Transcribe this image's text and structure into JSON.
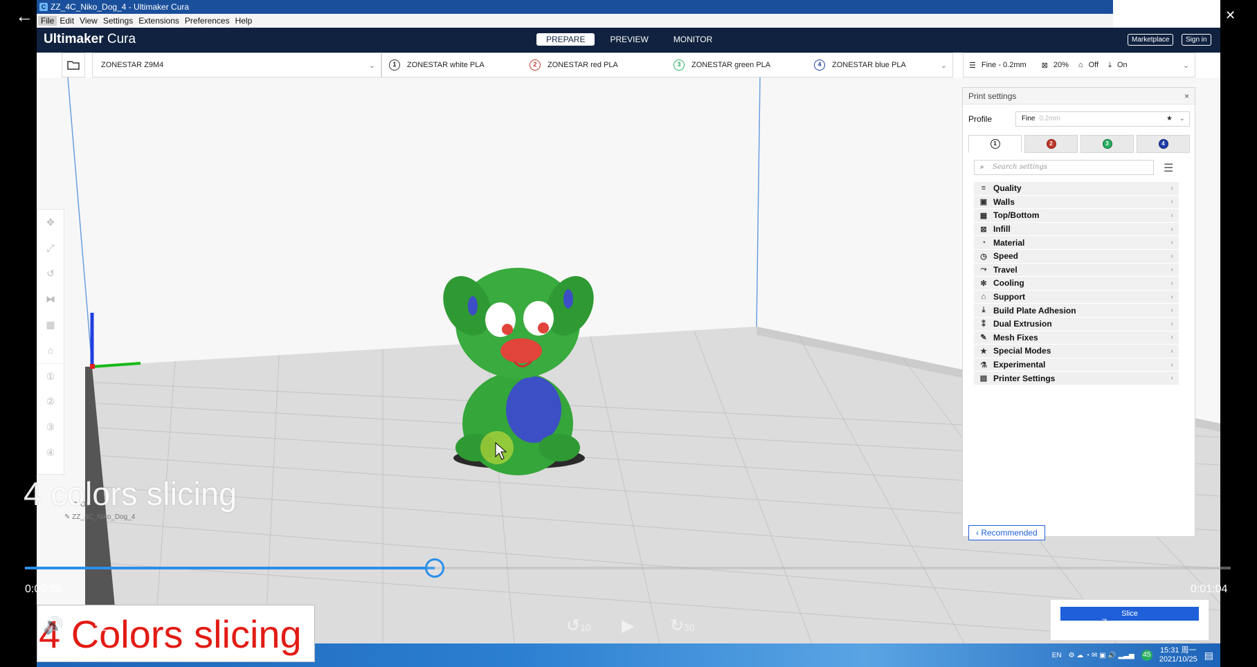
{
  "window": {
    "title": "ZZ_4C_Niko_Dog_4 - Ultimaker Cura"
  },
  "menu": [
    "File",
    "Edit",
    "View",
    "Settings",
    "Extensions",
    "Preferences",
    "Help"
  ],
  "header": {
    "brand_bold": "Ultimaker",
    "brand_rest": " Cura",
    "stages": [
      "PREPARE",
      "PREVIEW",
      "MONITOR"
    ],
    "active_stage": "PREPARE",
    "marketplace": "Marketplace",
    "signin": "Sign in"
  },
  "toolbar": {
    "printer": "ZONESTAR Z9M4",
    "extruders": [
      {
        "num": "1",
        "label": "ZONESTAR white PLA",
        "color": "#333333"
      },
      {
        "num": "2",
        "label": "ZONESTAR red PLA",
        "color": "#c0392b"
      },
      {
        "num": "3",
        "label": "ZONESTAR green PLA",
        "color": "#27ae60"
      },
      {
        "num": "4",
        "label": "ZONESTAR blue PLA",
        "color": "#1f3fa8"
      }
    ],
    "quality": "Fine - 0.2mm",
    "infill": "20%",
    "support": "Off",
    "adhesion": "On"
  },
  "panel": {
    "title": "Print settings",
    "close": "×",
    "profile_label": "Profile",
    "profile_value": "Fine",
    "profile_sub": "0.2mm",
    "search_placeholder": "Search settings",
    "categories": [
      {
        "icon": "quality-icon",
        "glyph": "≡",
        "label": "Quality"
      },
      {
        "icon": "walls-icon",
        "glyph": "▣",
        "label": "Walls"
      },
      {
        "icon": "top-bottom-icon",
        "glyph": "▦",
        "label": "Top/Bottom"
      },
      {
        "icon": "infill-icon",
        "glyph": "⊠",
        "label": "Infill"
      },
      {
        "icon": "material-icon",
        "glyph": "◔",
        "label": "Material"
      },
      {
        "icon": "speed-icon",
        "glyph": "◷",
        "label": "Speed"
      },
      {
        "icon": "travel-icon",
        "glyph": "⤳",
        "label": "Travel"
      },
      {
        "icon": "cooling-icon",
        "glyph": "✻",
        "label": "Cooling"
      },
      {
        "icon": "support-icon",
        "glyph": "⌂",
        "label": "Support"
      },
      {
        "icon": "adhesion-icon",
        "glyph": "⤓",
        "label": "Build Plate Adhesion"
      },
      {
        "icon": "dual-extrusion-icon",
        "glyph": "⁑",
        "label": "Dual Extrusion"
      },
      {
        "icon": "mesh-fixes-icon",
        "glyph": "✎",
        "label": "Mesh Fixes"
      },
      {
        "icon": "special-modes-icon",
        "glyph": "★",
        "label": "Special Modes"
      },
      {
        "icon": "experimental-icon",
        "glyph": "⚗",
        "label": "Experimental"
      },
      {
        "icon": "printer-settings-icon",
        "glyph": "▤",
        "label": "Printer Settings"
      }
    ],
    "recommended": "Recommended"
  },
  "slice": {
    "label": "Slice"
  },
  "object_list": {
    "header": "Ob",
    "item": "ZZ_4C_Niko_Dog_4"
  },
  "video": {
    "caption": "4 colors slicing",
    "red_caption": "4 Colors slicing",
    "time_current": "0:00:36",
    "time_total": "0:01:04",
    "progress": 0.34,
    "skip_back": "10",
    "skip_forward": "30"
  },
  "tray": {
    "lang": "EN",
    "time": "15:31 周一",
    "date": "2021/10/25",
    "badge": "45"
  }
}
